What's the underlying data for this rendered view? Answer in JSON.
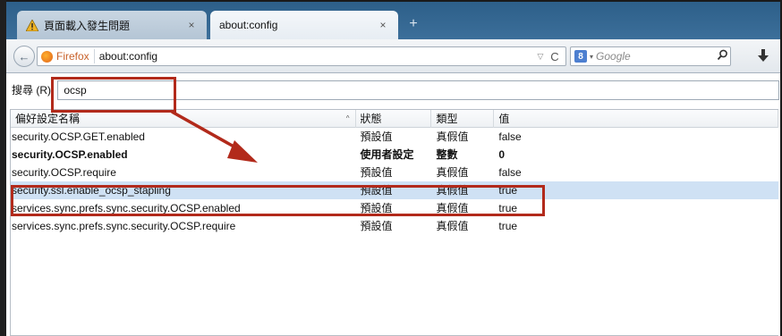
{
  "tabs": [
    {
      "label": "頁面載入發生問題",
      "close": "×",
      "icon": "warning-icon"
    },
    {
      "label": "about:config",
      "close": "×"
    }
  ],
  "new_tab": "+",
  "nav": {
    "back": "←",
    "identity": "Firefox",
    "url": "about:config",
    "dropdown": "▽",
    "reload": "C",
    "search_engine": "8",
    "search_drop": "▾",
    "search_placeholder": "Google",
    "search_go": "⚲",
    "download": "⬇"
  },
  "filter": {
    "label": "搜尋 (R):",
    "value": "ocsp"
  },
  "table": {
    "columns": [
      "偏好設定名稱",
      "狀態",
      "類型",
      "值"
    ],
    "sort_indicator": "^",
    "rows": [
      {
        "name": "security.OCSP.GET.enabled",
        "status": "預設值",
        "type": "真假值",
        "value": "false",
        "bold": false
      },
      {
        "name": "security.OCSP.enabled",
        "status": "使用者設定",
        "type": "整數",
        "value": "0",
        "bold": true
      },
      {
        "name": "security.OCSP.require",
        "status": "預設值",
        "type": "真假值",
        "value": "false",
        "bold": false
      },
      {
        "name": "security.ssl.enable_ocsp_stapling",
        "status": "預設值",
        "type": "真假值",
        "value": "true",
        "bold": false,
        "selected": true
      },
      {
        "name": "services.sync.prefs.sync.security.OCSP.enabled",
        "status": "預設值",
        "type": "真假值",
        "value": "true",
        "bold": false
      },
      {
        "name": "services.sync.prefs.sync.security.OCSP.require",
        "status": "預設值",
        "type": "真假值",
        "value": "true",
        "bold": false
      }
    ]
  },
  "colors": {
    "annotation": "#b22a1b",
    "tabstrip": "#2d5f89",
    "selected_row": "#cfe1f4"
  }
}
